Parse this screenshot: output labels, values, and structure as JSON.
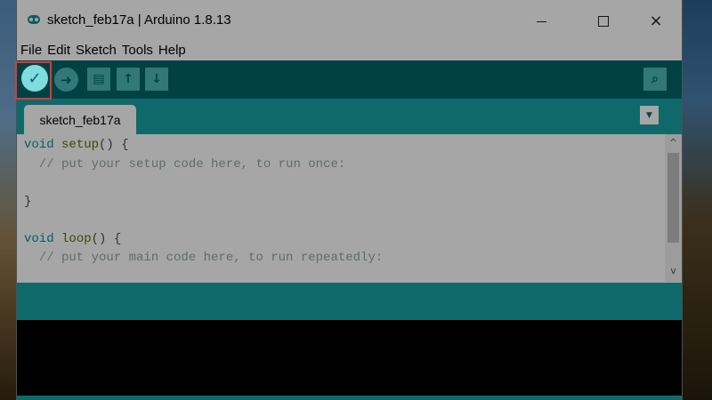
{
  "window": {
    "title": "sketch_feb17a | Arduino 1.8.13",
    "controls": {
      "minimize": "minimize",
      "maximize": "maximize",
      "close": "×"
    }
  },
  "menu": {
    "items": [
      {
        "label": "File"
      },
      {
        "label": "Edit"
      },
      {
        "label": "Sketch"
      },
      {
        "label": "Tools"
      },
      {
        "label": "Help"
      }
    ]
  },
  "toolbar": {
    "verify_icon": "✓",
    "upload_icon": "➜",
    "new_icon": "▤",
    "open_icon": "↑",
    "save_icon": "↓",
    "serial_icon": "⌕",
    "highlighted": "verify"
  },
  "tabs": {
    "active": "sketch_feb17a",
    "menu_icon": "▼"
  },
  "editor": {
    "lines": [
      {
        "type": "void",
        "fn": "setup",
        "rest": "() {"
      },
      {
        "comment": "  // put your setup code here, to run once:"
      },
      {
        "text": ""
      },
      {
        "text": "}"
      },
      {
        "text": ""
      },
      {
        "type": "void",
        "fn": "loop",
        "rest": "() {"
      },
      {
        "comment": "  // put your main code here, to run repeatedly:"
      }
    ],
    "scroll_up_icon": "^",
    "scroll_down_icon": "v"
  },
  "colors": {
    "toolbar": "#006468",
    "tabbar": "#17a1a5",
    "button": "#4db7bb",
    "highlight_border": "#d83a3a",
    "keyword": "#00979c",
    "function": "#5e6d03",
    "comment": "#95a5a6"
  }
}
